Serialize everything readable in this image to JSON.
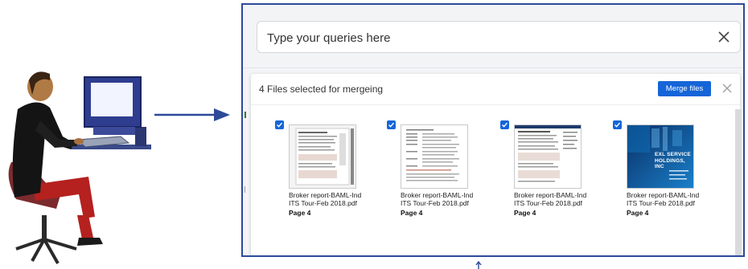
{
  "search": {
    "placeholder": "Type your queries here"
  },
  "panel": {
    "selection_text": "4 Files selected for mergeing",
    "merge_label": "Merge files"
  },
  "files": [
    {
      "name_line1": "Broker report-BAML-Ind",
      "name_line2": "ITS Tour-Feb 2018.pdf",
      "page": "Page 4",
      "selected": true
    },
    {
      "name_line1": "Broker report-BAML-Ind",
      "name_line2": "ITS Tour-Feb 2018.pdf",
      "page": "Page 4",
      "selected": true
    },
    {
      "name_line1": "Broker report-BAML-Ind",
      "name_line2": "ITS Tour-Feb 2018.pdf",
      "page": "Page 4",
      "selected": true
    },
    {
      "name_line1": "Broker report-BAML-Ind",
      "name_line2": "ITS Tour-Feb 2018.pdf",
      "page": "Page 4",
      "selected": true
    }
  ],
  "thumbnail_texts": {
    "cover_line1": "EXL SERVICE",
    "cover_line2": "HOLDINGS, INC"
  },
  "colors": {
    "accent": "#1565d8",
    "frame_border": "#2d4a9a"
  },
  "icons": {
    "user": "person-at-computer-icon",
    "arrow": "arrow-right-icon",
    "clear": "close-icon",
    "check": "checkbox-checked-icon"
  }
}
